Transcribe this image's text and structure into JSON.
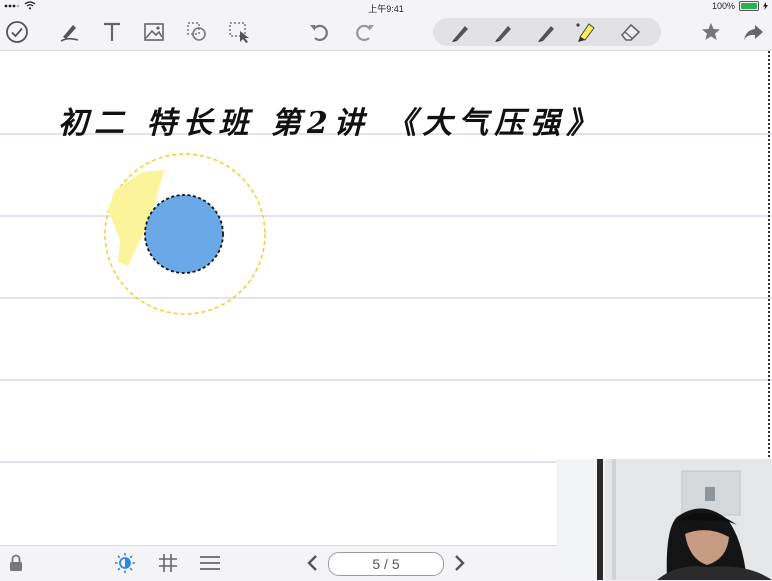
{
  "status_bar": {
    "time": "上午9:41",
    "battery": "100%"
  },
  "toolbar": {
    "icons": [
      "check-circle-icon",
      "pen-stroke-icon",
      "text-icon",
      "image-icon",
      "shape-icon",
      "select-icon",
      "undo-icon",
      "redo-icon",
      "pen-1-icon",
      "pen-2-icon",
      "pen-3-icon",
      "highlighter-icon",
      "eraser-icon",
      "star-icon",
      "share-icon"
    ],
    "highlighter_color": "#f7ee5a"
  },
  "canvas": {
    "heading": "初二 特长班 第2讲 《大气压强》",
    "circle_fill": "#6aa8e8",
    "halo_color": "#f0cf3a",
    "highlight_color": "#fbf49a"
  },
  "bottom_bar": {
    "page_indicator": "5 / 5",
    "accent": "#2e86de"
  }
}
